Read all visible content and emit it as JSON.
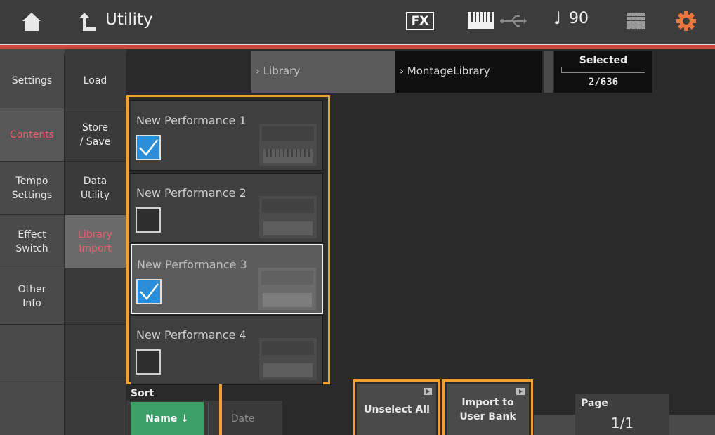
{
  "header": {
    "title": "Utility",
    "fx_label": "FX",
    "tempo_note": "♩",
    "tempo": "90"
  },
  "sidebar_left": [
    {
      "label": "Settings"
    },
    {
      "label": "Contents"
    },
    {
      "label": "Tempo\nSettings"
    },
    {
      "label": "Effect\nSwitch"
    },
    {
      "label": "Other\nInfo"
    }
  ],
  "sidebar_right": [
    {
      "label": "Load"
    },
    {
      "label": "Store\n/ Save"
    },
    {
      "label": "Data\nUtility"
    },
    {
      "label": "Library\nImport"
    }
  ],
  "breadcrumb": {
    "item1": "Library",
    "item2": "MontageLibrary"
  },
  "selected": {
    "label": "Selected",
    "value": "2/636"
  },
  "performances": [
    {
      "name": "New Performance 1",
      "checked": true
    },
    {
      "name": "New Performance 2",
      "checked": false
    },
    {
      "name": "New Performance 3",
      "checked": true
    },
    {
      "name": "New Performance 4",
      "checked": false
    }
  ],
  "sort": {
    "label": "Sort",
    "name_option": "Name ↓",
    "date_option": "Date"
  },
  "buttons": {
    "unselect_all": "Unselect All",
    "import_line1": "Import to",
    "import_line2": "User Bank"
  },
  "page": {
    "label": "Page",
    "value": "1/1"
  },
  "colors": {
    "accent_orange": "#f0a030",
    "active_red": "#e8606d",
    "check_blue": "#2a8fd8",
    "sort_green": "#3aa066"
  }
}
